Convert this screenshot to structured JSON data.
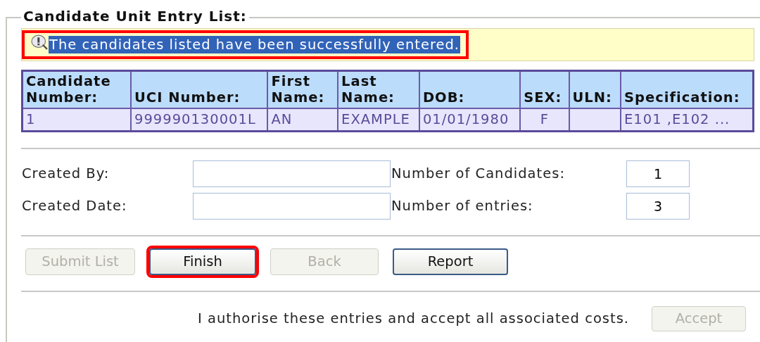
{
  "legend": "Candidate Unit Entry List:",
  "message": {
    "text": "The candidates listed have been successfully entered.",
    "selected": true,
    "highlighted": true
  },
  "table": {
    "columns": [
      "Candidate Number:",
      "UCI Number:",
      "First Name:",
      "Last Name:",
      "DOB:",
      "SEX:",
      "ULN:",
      "Specification:"
    ],
    "rows": [
      [
        "1",
        "999990130001L",
        "AN",
        "EXAMPLE",
        "01/01/1980",
        "F",
        "",
        "E101 ,E102 ..."
      ]
    ]
  },
  "fields": [
    {
      "label": "Created By:",
      "count_label": "Number of Candidates:",
      "count": "1"
    },
    {
      "label": "Created Date:",
      "count_label": "Number of entries:",
      "count": "3"
    }
  ],
  "buttons": [
    {
      "label": "Submit List",
      "disabled": true,
      "highlighted": false
    },
    {
      "label": "Finish",
      "disabled": false,
      "highlighted": true
    },
    {
      "label": "Back",
      "disabled": true,
      "highlighted": false
    },
    {
      "label": "Report",
      "disabled": false,
      "highlighted": false
    }
  ],
  "authorise": {
    "text": "I authorise these entries and accept all associated costs.",
    "button": {
      "label": "Accept",
      "disabled": true
    }
  }
}
